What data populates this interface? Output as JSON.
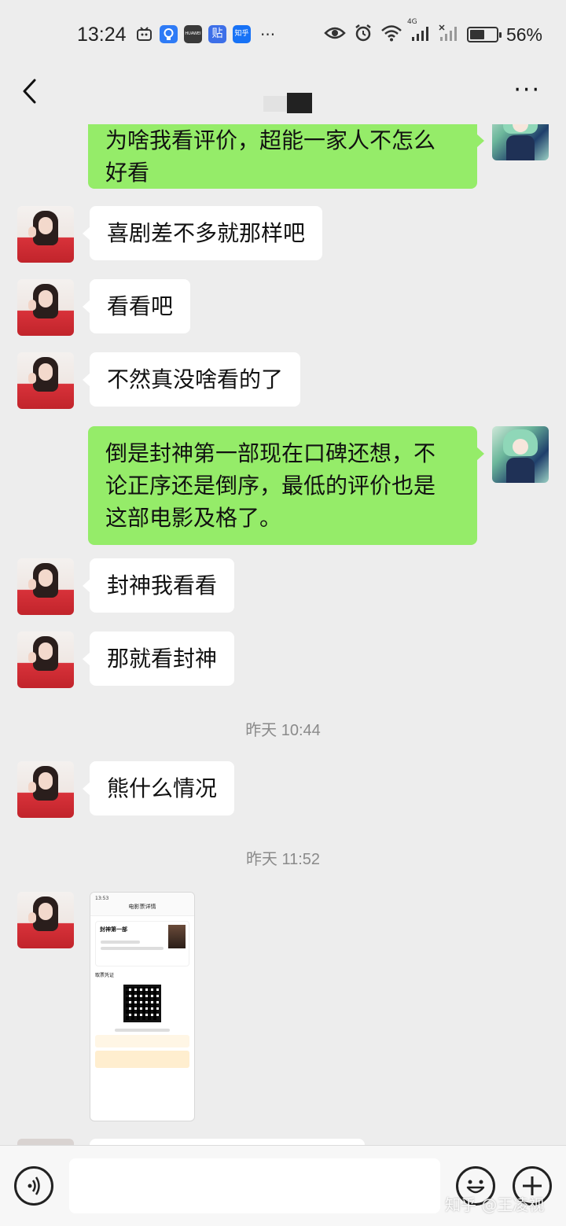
{
  "status_bar": {
    "time": "13:24",
    "battery_percent": "56%",
    "battery_level": 0.56,
    "network_label": "4G",
    "app_icons": [
      {
        "name": "bilibili-icon",
        "text": "",
        "color": "#333333"
      },
      {
        "name": "bulb-app-icon",
        "text": "",
        "color": "#2e7bf6"
      },
      {
        "name": "huawei-app-icon",
        "text": "HUAWEI",
        "color": "#3a3a3a"
      },
      {
        "name": "tieba-app-icon",
        "text": "贴",
        "color": "#3d6fe8"
      },
      {
        "name": "zhihu-app-icon",
        "text": "知乎",
        "color": "#1772f6"
      }
    ]
  },
  "header": {
    "back_icon": "chevron-left-icon",
    "more_icon": "more-dots-icon"
  },
  "messages": [
    {
      "id": "m1",
      "side": "out",
      "text_lines": [
        "为啥我看评价，超能一家人不怎么",
        "好看"
      ]
    },
    {
      "id": "m2",
      "side": "in",
      "text_lines": [
        "喜剧差不多就那样吧"
      ]
    },
    {
      "id": "m3",
      "side": "in",
      "text_lines": [
        "看看吧"
      ]
    },
    {
      "id": "m4",
      "side": "in",
      "text_lines": [
        "不然真没啥看的了"
      ]
    },
    {
      "id": "m5",
      "side": "out",
      "text_lines": [
        "倒是封神第一部现在口碑还想，不",
        "论正序还是倒序，最低的评价也是",
        "这部电影及格了。"
      ]
    },
    {
      "id": "m6",
      "side": "in",
      "text_lines": [
        "封神我看看"
      ]
    },
    {
      "id": "m7",
      "side": "in",
      "text_lines": [
        "那就看封神"
      ]
    },
    {
      "id": "t1",
      "type": "timestamp",
      "text": "昨天 10:44"
    },
    {
      "id": "m8",
      "side": "in",
      "text_lines": [
        "熊什么情况"
      ]
    },
    {
      "id": "t2",
      "type": "timestamp",
      "text": "昨天 11:52"
    }
  ],
  "shared_image": {
    "status_time": "13:53",
    "page_title": "电影票详情",
    "movie_title": "封神第一部",
    "section_label": "取票凭证"
  },
  "input_bar": {
    "voice_icon": "voice-icon",
    "placeholder": "",
    "emoji_icon": "emoji-icon",
    "plus_icon": "plus-icon"
  },
  "watermark": "知乎 @王凌视",
  "colors": {
    "background": "#ededed",
    "outgoing_bubble": "#95ec69",
    "incoming_bubble": "#ffffff",
    "timestamp": "#8a8a8a"
  }
}
